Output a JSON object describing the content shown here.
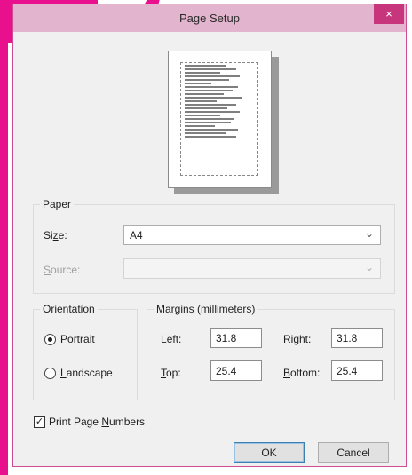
{
  "dialog": {
    "title": "Page Setup",
    "close_glyph": "×",
    "close_icon": "close-icon"
  },
  "paper": {
    "group_label": "Paper",
    "size_label_pre": "Si",
    "size_label_mn": "z",
    "size_label_post": "e:",
    "size_value": "A4",
    "source_label_pre": "",
    "source_label_mn": "S",
    "source_label_post": "ource:",
    "source_value": "",
    "dropdown_glyph": "⌄"
  },
  "orientation": {
    "group_label": "Orientation",
    "portrait_pre": "",
    "portrait_mn": "P",
    "portrait_post": "ortrait",
    "landscape_pre": "",
    "landscape_mn": "L",
    "landscape_post": "andscape",
    "selected": "portrait"
  },
  "margins": {
    "group_label": "Margins (millimeters)",
    "left_label_pre": "",
    "left_label_mn": "L",
    "left_label_post": "eft:",
    "left_value": "31.8",
    "right_label_pre": "",
    "right_label_mn": "R",
    "right_label_post": "ight:",
    "right_value": "31.8",
    "top_label_pre": "",
    "top_label_mn": "T",
    "top_label_post": "op:",
    "top_value": "25.4",
    "bottom_label_pre": "",
    "bottom_label_mn": "B",
    "bottom_label_post": "ottom:",
    "bottom_value": "25.4"
  },
  "options": {
    "print_page_numbers_pre": "Print Page ",
    "print_page_numbers_mn": "N",
    "print_page_numbers_post": "umbers",
    "print_page_numbers_checked": true,
    "check_glyph": "✓"
  },
  "buttons": {
    "ok": "OK",
    "cancel": "Cancel"
  },
  "colors": {
    "accent": "#e8108c",
    "titlebar": "#e3b4cd",
    "close_button": "#c7357d"
  }
}
